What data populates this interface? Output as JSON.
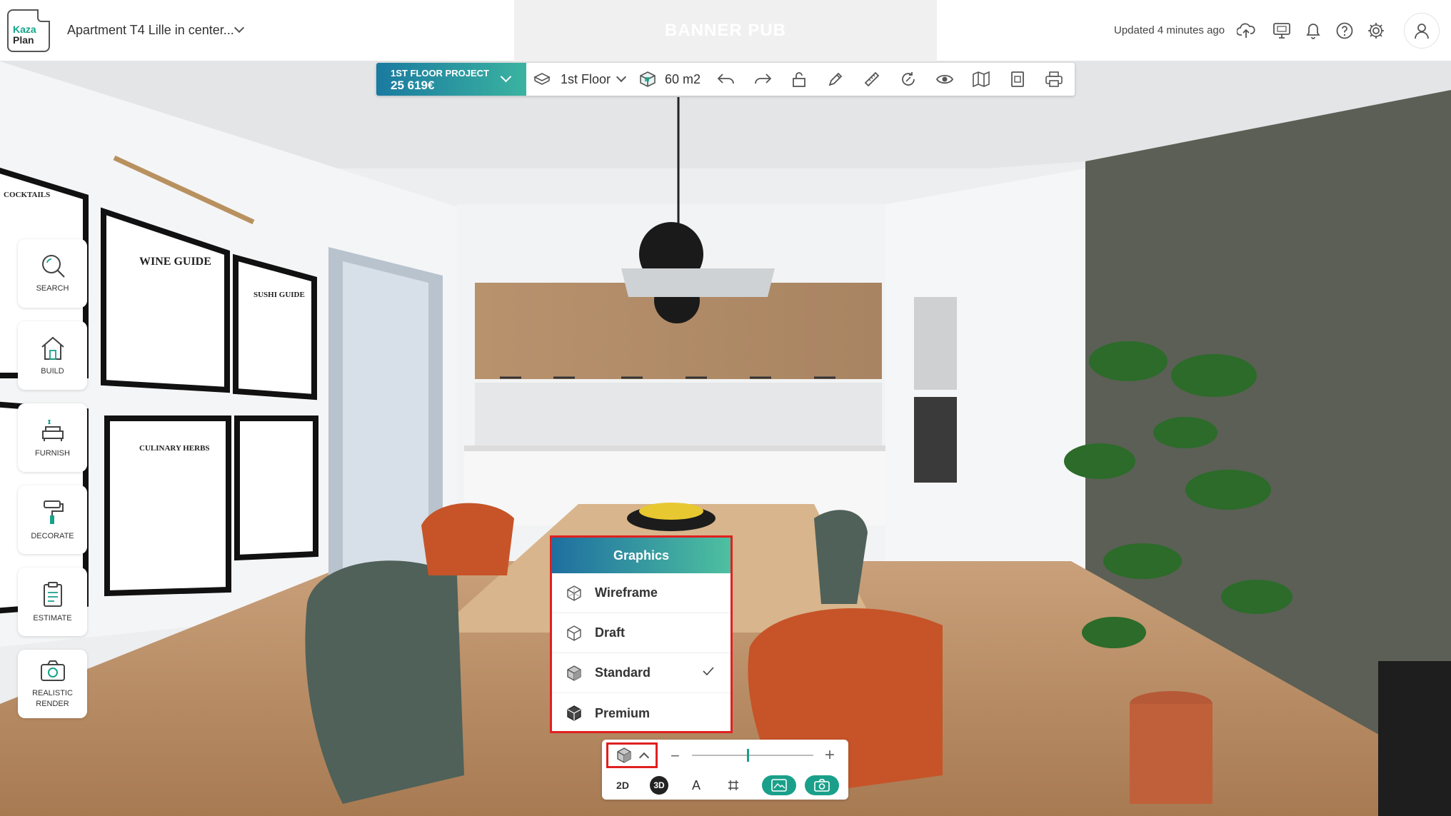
{
  "header": {
    "logo_line1": "Kaza",
    "logo_line2": "Plan",
    "project_title": "Apartment T4 Lille in center...",
    "banner": "BANNER PUB",
    "updated": "Updated 4 minutes ago",
    "icons": [
      "cloud-upload-icon",
      "monitor-icon",
      "bell-icon",
      "help-icon",
      "gear-icon",
      "user-icon"
    ]
  },
  "toolbar": {
    "project_name": "1ST FLOOR PROJECT",
    "project_price": "25 619€",
    "floor": "1st Floor",
    "area": "60 m2",
    "icons": [
      "undo-icon",
      "redo-icon",
      "lock-icon",
      "pen-icon",
      "ruler-icon",
      "rotate-icon",
      "eye-icon",
      "map-icon",
      "document-icon",
      "print-icon"
    ]
  },
  "sidebar": {
    "items": [
      {
        "label": "SEARCH",
        "icon": "search-icon"
      },
      {
        "label": "BUILD",
        "icon": "house-icon"
      },
      {
        "label": "FURNISH",
        "icon": "sofa-icon"
      },
      {
        "label": "DECORATE",
        "icon": "paint-roller-icon"
      },
      {
        "label": "ESTIMATE",
        "icon": "clipboard-icon"
      },
      {
        "label": "REALISTIC",
        "label2": "RENDER",
        "icon": "camera-icon"
      }
    ]
  },
  "graphics": {
    "title": "Graphics",
    "options": [
      {
        "label": "Wireframe",
        "selected": false
      },
      {
        "label": "Draft",
        "selected": false
      },
      {
        "label": "Standard",
        "selected": true
      },
      {
        "label": "Premium",
        "selected": false
      }
    ]
  },
  "bottom": {
    "zoom_minus": "−",
    "zoom_plus": "+",
    "zoom_level": 0.45,
    "mode_2d": "2D",
    "mode_3d": "3D",
    "mode_a": "A"
  },
  "scene_labels": {
    "poster1": "WINE GUIDE",
    "poster2": "SUSHI GUIDE",
    "poster3": "CULINARY HERBS",
    "poster4": "COCKTAILS"
  },
  "colors": {
    "accent": "#1aa08a",
    "highlight": "#e02020"
  }
}
